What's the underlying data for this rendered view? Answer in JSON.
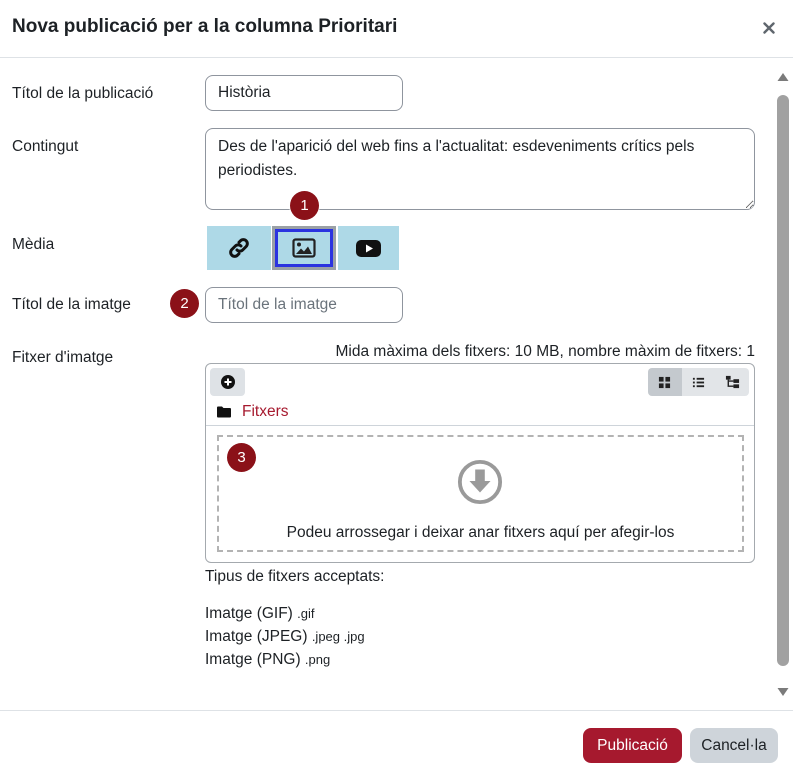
{
  "modal": {
    "title": "Nova publicació per a la columna Prioritari",
    "close_icon": "close-icon"
  },
  "form": {
    "post_title": {
      "label": "Títol de la publicació",
      "value": "Història"
    },
    "content": {
      "label": "Contingut",
      "value": "Des de l'aparició del web fins a l'actualitat: esdeveniments crítics pels periodistes."
    },
    "media": {
      "label": "Mèdia",
      "options": [
        {
          "icon": "link-icon",
          "selected": false
        },
        {
          "icon": "image-icon",
          "selected": true
        },
        {
          "icon": "youtube-icon",
          "selected": false
        }
      ]
    },
    "image_title": {
      "label": "Títol de la imatge",
      "placeholder": "Títol de la imatge"
    },
    "image_file": {
      "label": "Fitxer d'imatge",
      "limits": "Mida màxima dels fitxers: 10 MB, nombre màxim de fitxers: 1",
      "add_icon": "add-file-icon",
      "view_modes": [
        {
          "icon": "grid-icon",
          "selected": true
        },
        {
          "icon": "list-icon",
          "selected": false
        },
        {
          "icon": "tree-icon",
          "selected": false
        }
      ],
      "folder_icon": "folder-icon",
      "folder": "Fitxers",
      "dropzone_icon": "download-circle-icon",
      "dropzone_text": "Podeu arrossegar i deixar anar fitxers aquí per afegir-los"
    },
    "accepted": {
      "heading": "Tipus de fitxers acceptats:",
      "types": [
        {
          "name": "Imatge (GIF)",
          "ext": ".gif"
        },
        {
          "name": "Imatge (JPEG)",
          "ext": ".jpeg .jpg"
        },
        {
          "name": "Imatge (PNG)",
          "ext": ".png"
        }
      ]
    }
  },
  "annotations": [
    {
      "label": "1"
    },
    {
      "label": "2"
    },
    {
      "label": "3"
    }
  ],
  "footer": {
    "submit_label": "Publicació",
    "cancel_label": "Cancel·la"
  },
  "colors": {
    "brand": "#a6192e",
    "annotation_badge": "#8b1118",
    "media_button_bg": "#aed9e7",
    "selected_border": "#2b33e0"
  }
}
